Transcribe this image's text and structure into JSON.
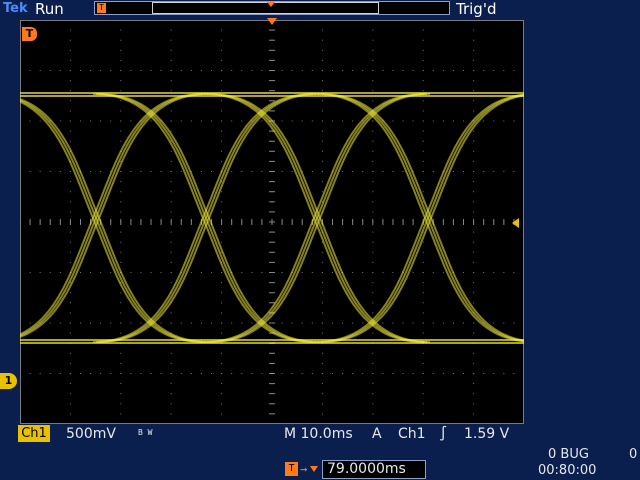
{
  "header": {
    "brand": "Tek",
    "acq_state": "Run",
    "trig_status": "Trig'd"
  },
  "markers": {
    "trigger_position": "T",
    "channel": "1"
  },
  "status": {
    "channel": "Ch1",
    "volts_div": "500mV",
    "bw_limit": "B W",
    "timebase": "M 10.0ms",
    "trig_mode": "A",
    "trig_source": "Ch1",
    "trig_slope": "∫",
    "trig_level": "1.59 V"
  },
  "delay": {
    "value": "79.0000ms"
  },
  "footer": {
    "bug_text": "0 BUG",
    "right_zero": "0",
    "clock": "00:80:00"
  },
  "colors": {
    "trace": "#f4ec3a",
    "accent_orange": "#ff7a1a",
    "channel_yellow": "#e8c200",
    "background": "#0b1f4f"
  }
}
